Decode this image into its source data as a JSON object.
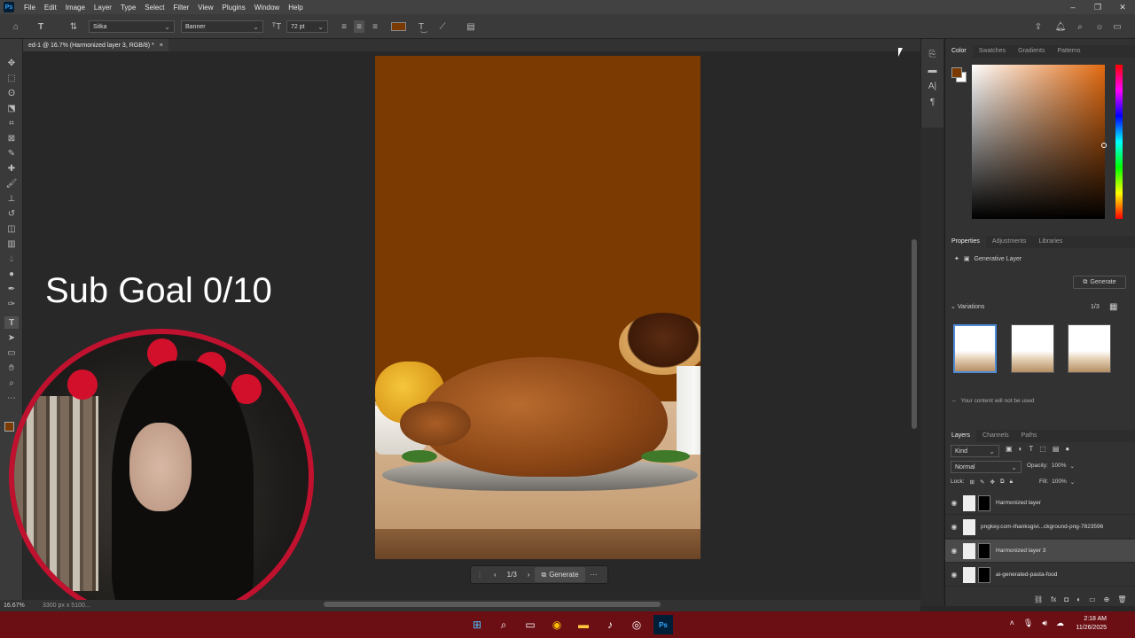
{
  "app": {
    "logo": "Ps",
    "window_title": "Adobe Photoshop"
  },
  "menu": [
    "File",
    "Edit",
    "Image",
    "Layer",
    "Type",
    "Select",
    "Filter",
    "View",
    "Plugins",
    "Window",
    "Help"
  ],
  "window_controls": [
    "–",
    "❐",
    "✕"
  ],
  "options_bar": {
    "font_family": "Sitka",
    "font_style": "Banner",
    "font_size": "72 pt",
    "text_color": "#7a3a02"
  },
  "document_tab": {
    "title": "ed-1 @ 16.7% (Harmonized layer 3, RGB/8) *",
    "close": "×"
  },
  "overlay": {
    "sub_goal": "Sub Goal 0/10"
  },
  "context_bar": {
    "page": "1/3",
    "generate_label": "Generate",
    "more": "···"
  },
  "status_bar": {
    "zoom": "16.67%",
    "dimensions": "3300 px x 5100..."
  },
  "color_panel": {
    "tabs": [
      "Color",
      "Swatches",
      "Gradients",
      "Patterns"
    ],
    "foreground": "#7a3a02",
    "background": "#ffffff"
  },
  "properties_panel": {
    "tabs": [
      "Properties",
      "Adjustments",
      "Libraries"
    ],
    "layer_type": "Generative Layer",
    "generate_label": "Generate",
    "variations_label": "Variations",
    "variations_count": "1/3",
    "notice": "Your content will not be used"
  },
  "layers_panel": {
    "tabs": [
      "Layers",
      "Channels",
      "Paths"
    ],
    "filter_kind": "Kind",
    "blend_mode": "Normal",
    "opacity_label": "Opacity:",
    "opacity_value": "100%",
    "lock_label": "Lock:",
    "fill_label": "Fill:",
    "fill_value": "100%",
    "layers": [
      {
        "name": "Harmonized layer",
        "selected": false
      },
      {
        "name": "pngkey.com-thanksgivi...ckground-png-7823596",
        "selected": false
      },
      {
        "name": "Harmonized layer 3",
        "selected": true
      },
      {
        "name": "ai-generated-pasta-food",
        "selected": false
      }
    ]
  },
  "taskbar": {
    "time": "2:18 AM",
    "date": "11/26/2025",
    "accent": "#6b0f14"
  }
}
